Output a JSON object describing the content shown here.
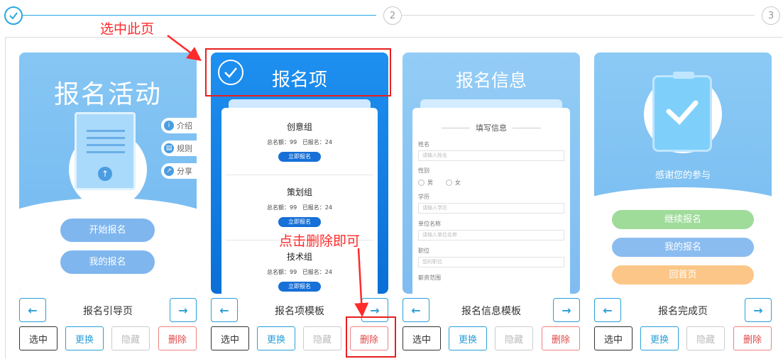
{
  "stepper": {
    "step2": "2",
    "step3": "3"
  },
  "annotations": {
    "select_page": "选中此页",
    "click_delete": "点击删除即可"
  },
  "cards": {
    "guide": {
      "title": "报名活动",
      "tabs": [
        "介绍",
        "规则",
        "分享"
      ],
      "buttons": [
        "开始报名",
        "我的报名"
      ],
      "label": "报名引导页"
    },
    "items": {
      "title": "报名项",
      "groups": [
        {
          "name": "创意组",
          "quota": "总名额：99",
          "count": "已报名：24",
          "button": "立即报名"
        },
        {
          "name": "策划组",
          "quota": "总名额：99",
          "count": "已报名：24",
          "button": "立即报名"
        },
        {
          "name": "技术组",
          "quota": "总名额：99",
          "count": "已报名：24",
          "button": "立即报名"
        }
      ],
      "label": "报名项模板"
    },
    "info": {
      "title": "报名信息",
      "form_title": "填写信息",
      "fields": [
        {
          "label": "姓名",
          "placeholder": "请输入姓名"
        },
        {
          "label": "性别",
          "options": [
            "男",
            "女"
          ]
        },
        {
          "label": "学历",
          "placeholder": "请输入学历"
        },
        {
          "label": "单位名称",
          "placeholder": "请输入单位名称"
        },
        {
          "label": "职位",
          "placeholder": "您的职位"
        },
        {
          "label": "薪资范围"
        }
      ],
      "label": "报名信息模板"
    },
    "done": {
      "thanks": "感谢您的参与",
      "buttons": [
        "继续报名",
        "我的报名",
        "回首页"
      ],
      "label": "报名完成页"
    }
  },
  "actions": {
    "select": "选中",
    "replace": "更换",
    "hide": "隐藏",
    "delete": "删除"
  },
  "colors": {
    "accent": "#2a9fd8",
    "delete": "#e04848",
    "annotation": "#ff2a2a",
    "continue": "#9fdc9a",
    "home": "#fbc687"
  }
}
